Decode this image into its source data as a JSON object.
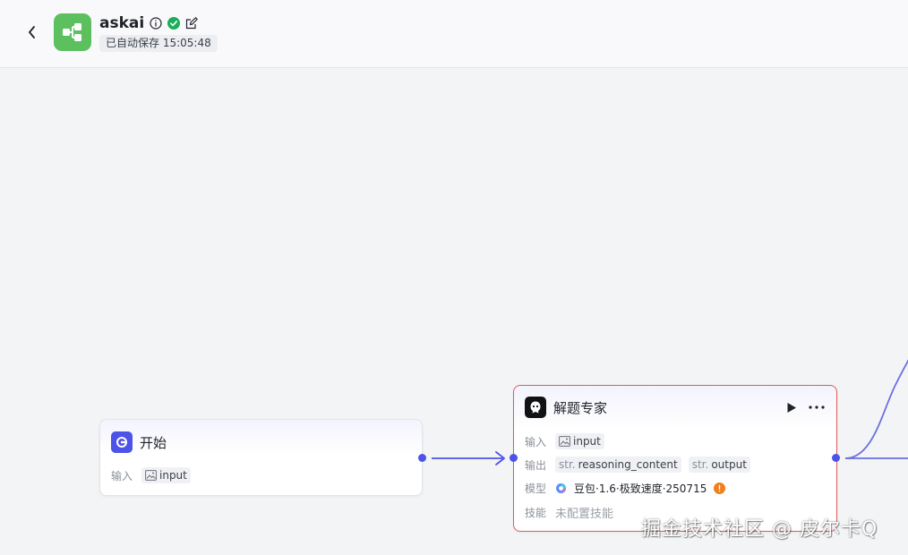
{
  "header": {
    "app_name": "askai",
    "autosave_label": "已自动保存 15:05:48"
  },
  "colors": {
    "accent": "#4d53e8",
    "logo_bg": "#5cc05f",
    "success": "#1aad5a",
    "error_border": "#e05b5b",
    "warning": "#f07d1e"
  },
  "nodes": {
    "start": {
      "title": "开始",
      "input_label": "输入",
      "input_param": "input"
    },
    "expert": {
      "title": "解题专家",
      "input_label": "输入",
      "input_param": "input",
      "output_label": "输出",
      "outputs": [
        {
          "type": "str.",
          "name": "reasoning_content"
        },
        {
          "type": "str.",
          "name": "output"
        }
      ],
      "model_label": "模型",
      "model_value": "豆包·1.6·极致速度·250715",
      "skill_label": "技能",
      "skill_value": "未配置技能"
    }
  },
  "watermark": "掘金技术社区 @ 皮尔卡Q"
}
